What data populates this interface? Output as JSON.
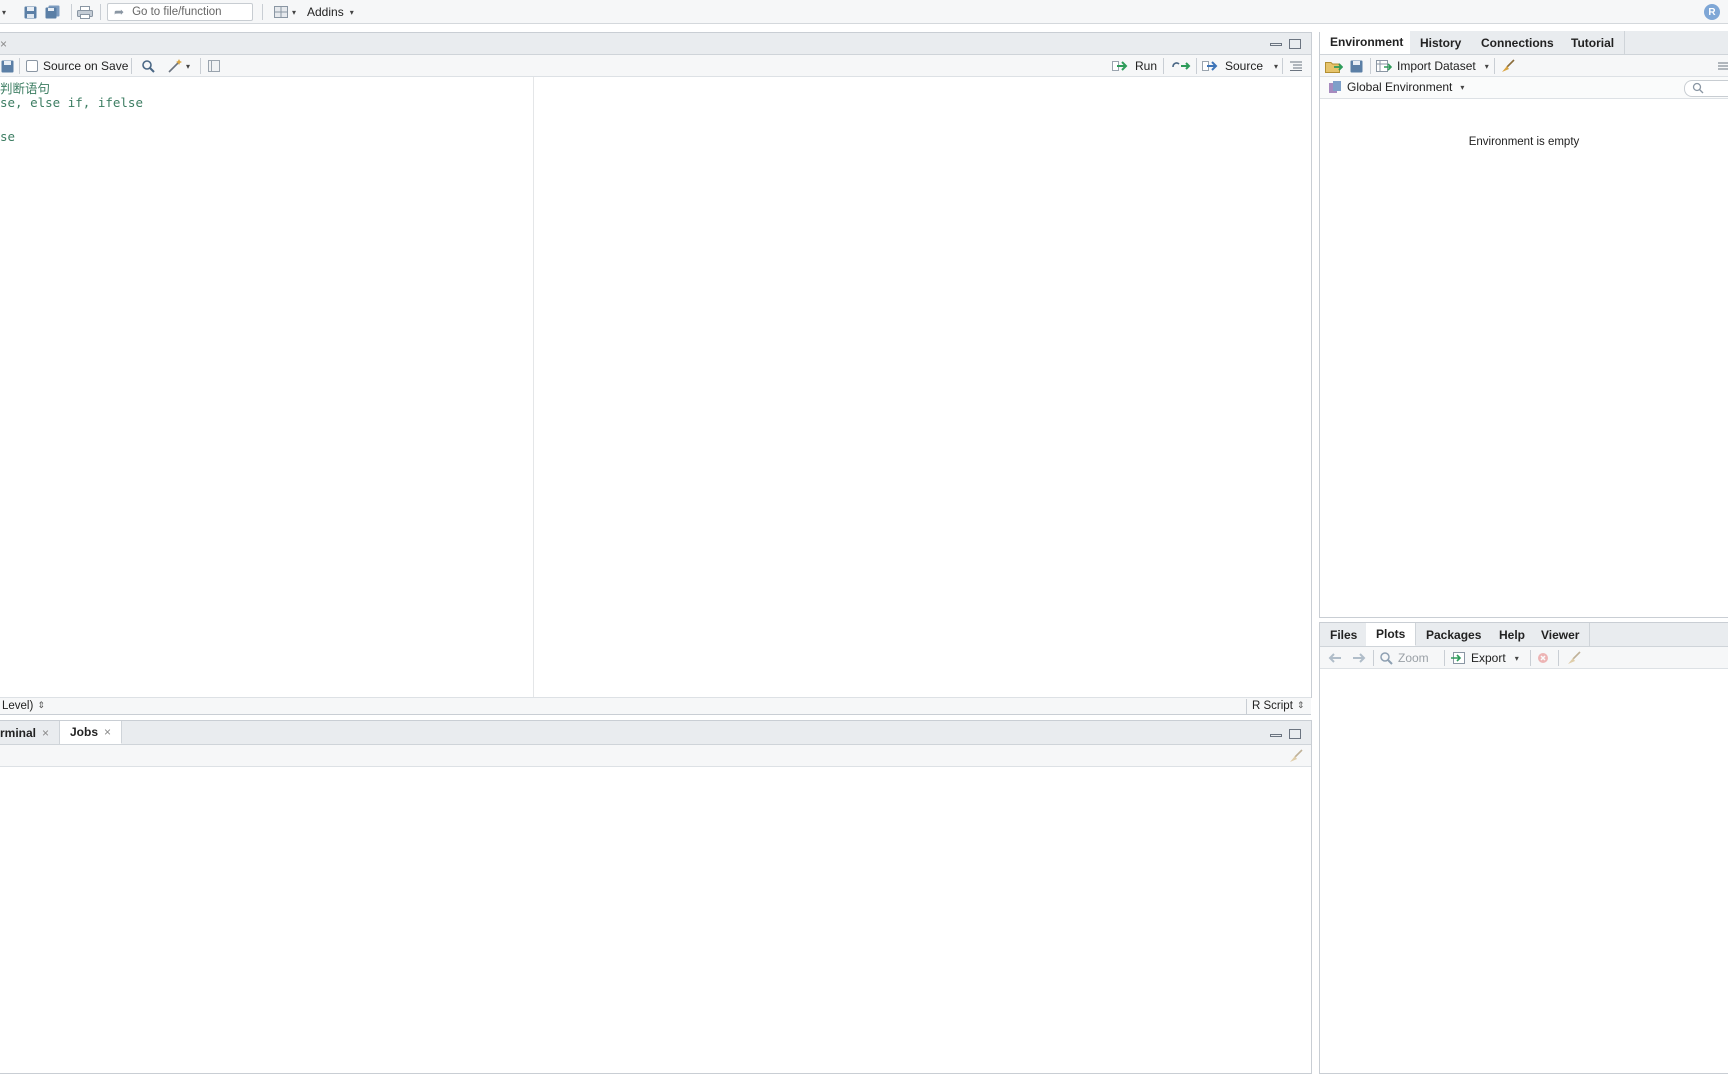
{
  "toolbar": {
    "goto_placeholder": "Go to file/function",
    "addins_label": "Addins"
  },
  "editor": {
    "source_on_save_label": "Source on Save",
    "run_label": "Run",
    "source_label": "Source",
    "code_lines": [
      "判断语句",
      "se, else if, ifelse",
      "",
      "se"
    ],
    "status_left": "Level)",
    "status_right": "R Script"
  },
  "console": {
    "tabs": [
      {
        "label": "rminal"
      },
      {
        "label": "Jobs"
      }
    ]
  },
  "environment": {
    "tabs": [
      {
        "label": "Environment",
        "active": true
      },
      {
        "label": "History"
      },
      {
        "label": "Connections"
      },
      {
        "label": "Tutorial"
      }
    ],
    "import_label": "Import Dataset",
    "scope_label": "Global Environment",
    "empty_message": "Environment is empty"
  },
  "files": {
    "tabs": [
      {
        "label": "Files"
      },
      {
        "label": "Plots",
        "active": true
      },
      {
        "label": "Packages"
      },
      {
        "label": "Help"
      },
      {
        "label": "Viewer"
      }
    ],
    "zoom_label": "Zoom",
    "export_label": "Export"
  },
  "colors": {
    "tab_strip": "#e9ecef",
    "toolbar": "#f6f7f8",
    "code_green": "#3c7d62",
    "run_arrow": "#2e9c5a"
  }
}
